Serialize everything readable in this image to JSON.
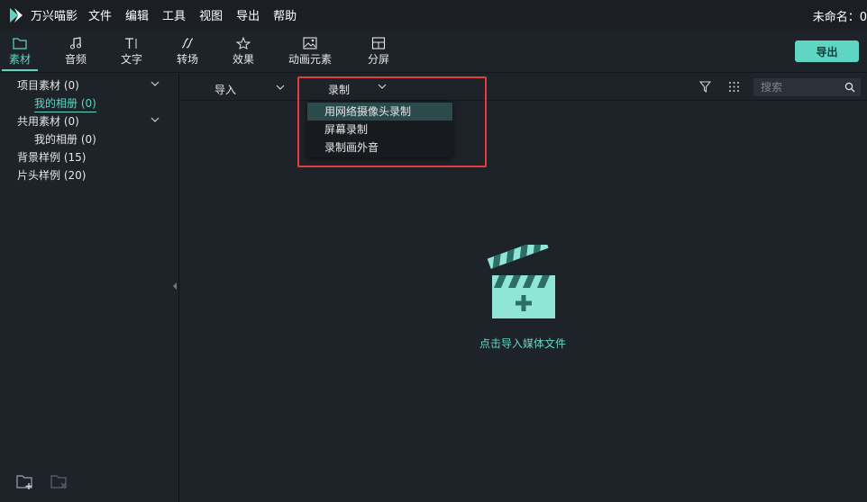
{
  "menubar": {
    "app_title": "万兴喵影",
    "items": [
      "文件",
      "编辑",
      "工具",
      "视图",
      "导出",
      "帮助"
    ],
    "doc_title": "未命名：0"
  },
  "toolbar": {
    "tabs": [
      {
        "label": "素材",
        "icon": "folder-icon"
      },
      {
        "label": "音频",
        "icon": "music-note-icon"
      },
      {
        "label": "文字",
        "icon": "text-icon"
      },
      {
        "label": "转场",
        "icon": "transition-icon"
      },
      {
        "label": "效果",
        "icon": "effects-icon"
      },
      {
        "label": "动画元素",
        "icon": "image-icon"
      },
      {
        "label": "分屏",
        "icon": "split-screen-icon"
      }
    ],
    "active_tab": "素材",
    "export_label": "导出"
  },
  "sidebar": {
    "items": [
      {
        "label": "项目素材 (0)",
        "expanded": true
      },
      {
        "label": "我的相册 (0)",
        "selected": true
      },
      {
        "label": "共用素材 (0)",
        "expanded": true
      },
      {
        "label": "我的相册 (0)"
      },
      {
        "label": "背景样例 (15)"
      },
      {
        "label": "片头样例 (20)"
      }
    ]
  },
  "media": {
    "import_label": "导入",
    "record_label": "录制",
    "search_placeholder": "搜索",
    "record_menu": [
      "用网络摄像头录制",
      "屏幕录制",
      "录制画外音"
    ],
    "empty_text": "点击导入媒体文件"
  },
  "colors": {
    "accent": "#5fd6c4",
    "highlight": "#e0403f",
    "background": "#1e2329"
  }
}
